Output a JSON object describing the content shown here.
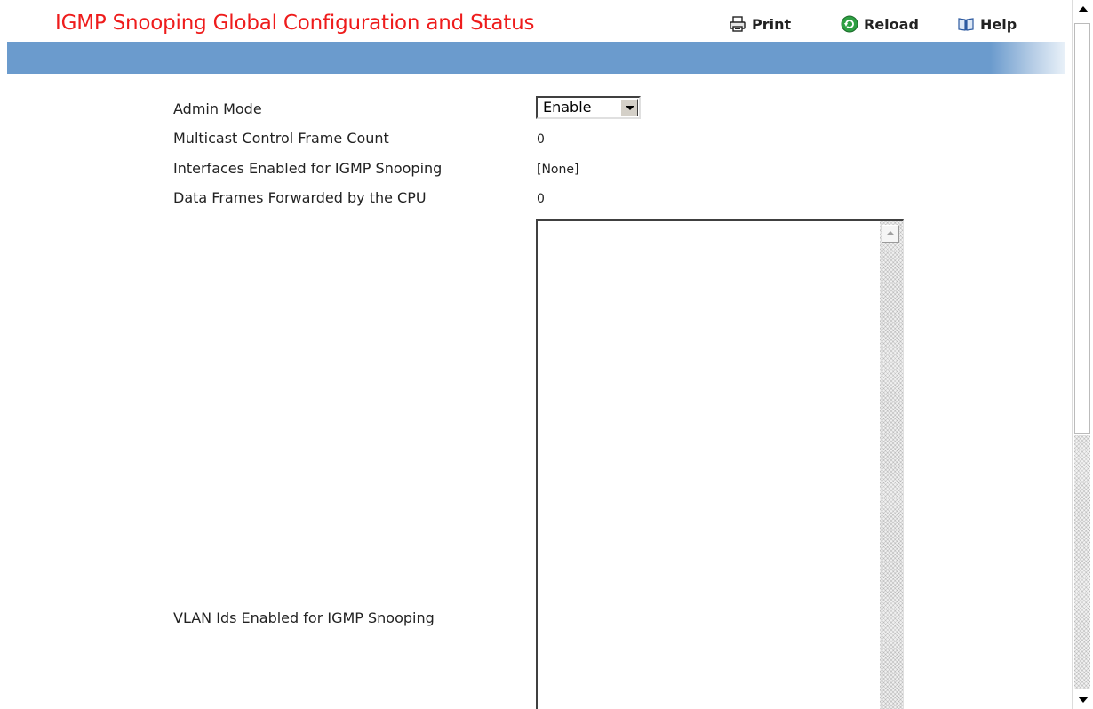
{
  "header": {
    "title": "IGMP Snooping Global Configuration and Status",
    "title_color": "#ee1c1c",
    "print_label": "Print",
    "reload_label": "Reload",
    "help_label": "Help",
    "print_icon": "printer-icon",
    "reload_icon": "reload-icon",
    "help_icon": "help-book-icon"
  },
  "banner": {
    "color": "#6b9bcd"
  },
  "form": {
    "admin_mode": {
      "label": "Admin Mode",
      "value": "Enable",
      "options_visible": [
        "Enable"
      ]
    },
    "multicast_control_frame_count": {
      "label": "Multicast Control Frame Count",
      "value": "0"
    },
    "interfaces_enabled": {
      "label": "Interfaces Enabled for IGMP Snooping",
      "value": "[None]"
    },
    "data_frames_forwarded": {
      "label": "Data Frames Forwarded by the CPU",
      "value": "0"
    },
    "vlan_ids_enabled": {
      "label": "VLAN Ids Enabled for IGMP Snooping",
      "items": []
    }
  }
}
